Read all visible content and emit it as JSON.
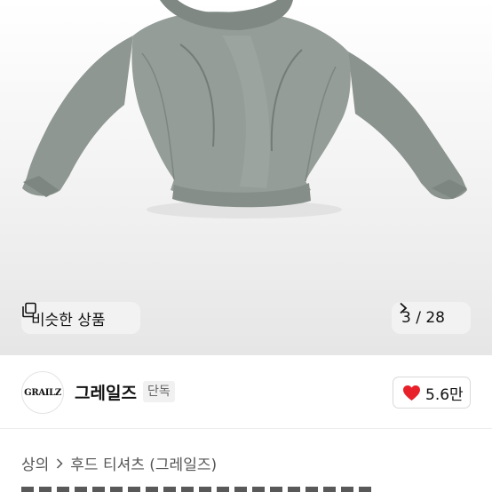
{
  "product_image": {
    "subject": "grey hoodie",
    "similar_button_label": "비슷한 상품",
    "similar_icon": "copy-icon",
    "pager_text": "3 / 28",
    "pager_icon": "chevron-right-icon",
    "hoodie_color": "#8b948f"
  },
  "seller": {
    "logo_text": "GRAILZ",
    "name": "그레일즈",
    "badge": "단독",
    "like_icon": "heart-icon",
    "like_count": "5.6만",
    "like_color": "#e8202a"
  },
  "breadcrumb": {
    "level1": "상의",
    "level2": "후드 티셔츠 (그레일즈)",
    "separator_icon": "chevron-right-icon"
  }
}
